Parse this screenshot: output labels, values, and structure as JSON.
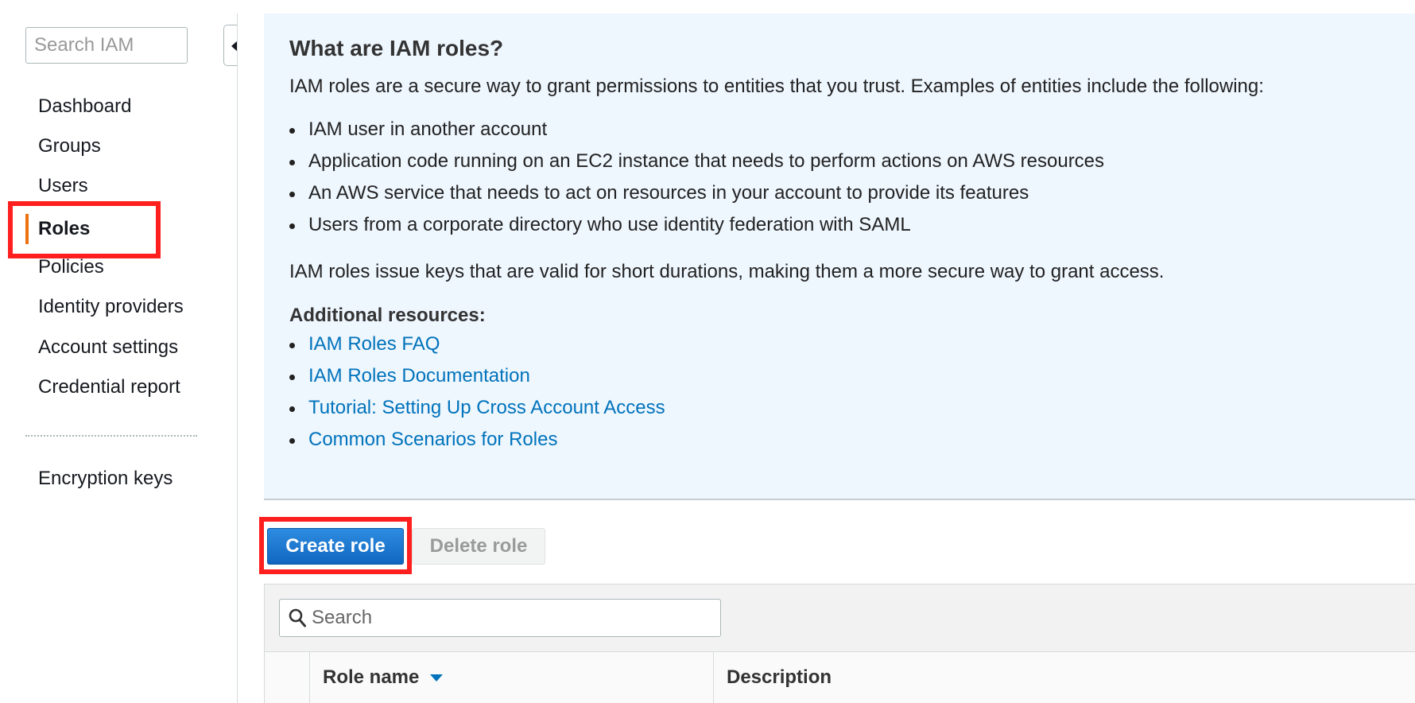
{
  "sidebar": {
    "search_placeholder": "Search IAM",
    "items": [
      {
        "label": "Dashboard"
      },
      {
        "label": "Groups"
      },
      {
        "label": "Users"
      },
      {
        "label": "Roles",
        "active": true
      },
      {
        "label": "Policies"
      },
      {
        "label": "Identity providers"
      },
      {
        "label": "Account settings"
      },
      {
        "label": "Credential report"
      }
    ],
    "extra_items": [
      {
        "label": "Encryption keys"
      }
    ]
  },
  "info": {
    "title": "What are IAM roles?",
    "intro": "IAM roles are a secure way to grant permissions to entities that you trust. Examples of entities include the following:",
    "examples": [
      "IAM user in another account",
      "Application code running on an EC2 instance that needs to perform actions on AWS resources",
      "An AWS service that needs to act on resources in your account to provide its features",
      "Users from a corporate directory who use identity federation with SAML"
    ],
    "note": "IAM roles issue keys that are valid for short durations, making them a more secure way to grant access.",
    "resources_heading": "Additional resources:",
    "resources": [
      "IAM Roles FAQ",
      "IAM Roles Documentation",
      "Tutorial: Setting Up Cross Account Access",
      "Common Scenarios for Roles"
    ]
  },
  "actions": {
    "create_label": "Create role",
    "delete_label": "Delete role"
  },
  "table": {
    "search_placeholder": "Search",
    "columns": [
      {
        "label": "Role name",
        "sorted": "desc"
      },
      {
        "label": "Description"
      }
    ]
  },
  "colors": {
    "accent": "#ec7211",
    "link": "#0073bb",
    "primary_button": "#1167c0",
    "info_background": "#eef6fe",
    "highlight": "#ff1f1f"
  }
}
